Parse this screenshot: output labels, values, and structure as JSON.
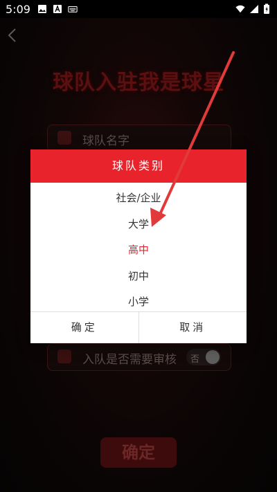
{
  "status_bar": {
    "time": "5:09",
    "icons_left": [
      "image-icon",
      "a-icon",
      "keyboard-icon"
    ],
    "icons_right": [
      "wifi-icon",
      "signal-icon",
      "battery-icon"
    ]
  },
  "background": {
    "title": "球队入驻我是球星",
    "team_name_placeholder": "球队名字",
    "review_label": "入队是否需要审核",
    "review_toggle_text": "否",
    "confirm_label": "确定"
  },
  "dialog": {
    "title": "球队类别",
    "options": [
      {
        "label": "社会/企业",
        "selected": false
      },
      {
        "label": "大学",
        "selected": false
      },
      {
        "label": "高中",
        "selected": true
      },
      {
        "label": "初中",
        "selected": false
      },
      {
        "label": "小学",
        "selected": false
      }
    ],
    "confirm_label": "确定",
    "cancel_label": "取消"
  },
  "colors": {
    "accent": "#e8232b",
    "annotation_arrow": "#e03a3a"
  }
}
